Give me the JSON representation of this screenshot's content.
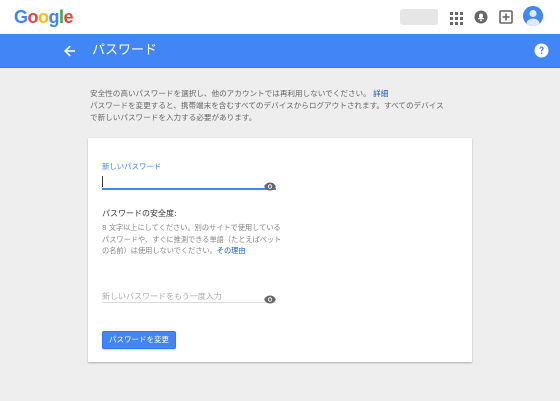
{
  "topbar": {
    "logo_letters": [
      "G",
      "o",
      "o",
      "g",
      "l",
      "e"
    ],
    "icons": [
      "apps-grid-icon",
      "notifications-icon",
      "share-plus-icon",
      "account-avatar-icon"
    ]
  },
  "header": {
    "title": "パスワード",
    "background_color": "#4285f4",
    "icons": [
      "back-arrow-icon",
      "help-icon"
    ]
  },
  "intro": {
    "line1": "安全性の高いパスワードを選択し、他のアカウントでは再利用しないでください。",
    "line1_link": "詳細",
    "line2": "パスワードを変更すると、携帯端末を含むすべてのデバイスからログアウトされます。すべてのデバイス",
    "line3": "で新しいパスワードを入力する必要があります。"
  },
  "form": {
    "new_password_label": "新しいパスワード",
    "new_password_value": "",
    "strength_title": "パスワードの安全度:",
    "strength_hint": "8 文字以上にしてください。別のサイトで使用しているパスワードや、すぐに推測できる単語（たとえばペットの名前）は使用しないでください。",
    "strength_link": "その理由",
    "confirm_placeholder": "新しいパスワードをもう一度入力",
    "submit_label": "パスワードを変更"
  }
}
